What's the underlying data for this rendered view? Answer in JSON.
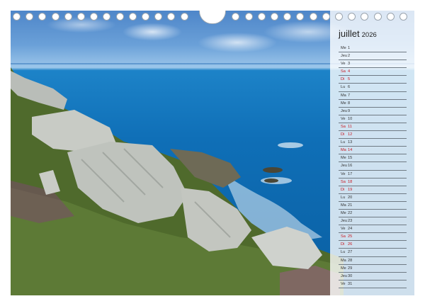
{
  "calendar": {
    "month": "juillet",
    "year": "2026",
    "days": [
      {
        "wd": "Me",
        "num": "1",
        "weekend": false
      },
      {
        "wd": "Jeu",
        "num": "2",
        "weekend": false
      },
      {
        "wd": "Ve",
        "num": "3",
        "weekend": false
      },
      {
        "wd": "Sa",
        "num": "4",
        "weekend": true
      },
      {
        "wd": "Di",
        "num": "5",
        "weekend": true
      },
      {
        "wd": "Lu",
        "num": "6",
        "weekend": false
      },
      {
        "wd": "Ma",
        "num": "7",
        "weekend": false
      },
      {
        "wd": "Me",
        "num": "8",
        "weekend": false
      },
      {
        "wd": "Jeu",
        "num": "9",
        "weekend": false
      },
      {
        "wd": "Ve",
        "num": "10",
        "weekend": false
      },
      {
        "wd": "Sa",
        "num": "11",
        "weekend": true
      },
      {
        "wd": "Di",
        "num": "12",
        "weekend": true
      },
      {
        "wd": "Lu",
        "num": "13",
        "weekend": false
      },
      {
        "wd": "Ma",
        "num": "14",
        "weekend": true
      },
      {
        "wd": "Me",
        "num": "15",
        "weekend": false
      },
      {
        "wd": "Jeu",
        "num": "16",
        "weekend": false
      },
      {
        "wd": "Ve",
        "num": "17",
        "weekend": false
      },
      {
        "wd": "Sa",
        "num": "18",
        "weekend": true
      },
      {
        "wd": "Di",
        "num": "19",
        "weekend": true
      },
      {
        "wd": "Lu",
        "num": "20",
        "weekend": false
      },
      {
        "wd": "Ma",
        "num": "21",
        "weekend": false
      },
      {
        "wd": "Me",
        "num": "22",
        "weekend": false
      },
      {
        "wd": "Jeu",
        "num": "23",
        "weekend": false
      },
      {
        "wd": "Ve",
        "num": "24",
        "weekend": false
      },
      {
        "wd": "Sa",
        "num": "25",
        "weekend": true
      },
      {
        "wd": "Di",
        "num": "26",
        "weekend": true
      },
      {
        "wd": "Lu",
        "num": "27",
        "weekend": false
      },
      {
        "wd": "Ma",
        "num": "28",
        "weekend": false
      },
      {
        "wd": "Me",
        "num": "29",
        "weekend": false
      },
      {
        "wd": "Jeu",
        "num": "30",
        "weekend": false
      },
      {
        "wd": "Ve",
        "num": "31",
        "weekend": false
      }
    ]
  },
  "binding": {
    "hole_count": 31
  },
  "colors": {
    "weekend": "#c8171f",
    "sea": "#0f6fb7",
    "sky": "#6aa0d8"
  }
}
